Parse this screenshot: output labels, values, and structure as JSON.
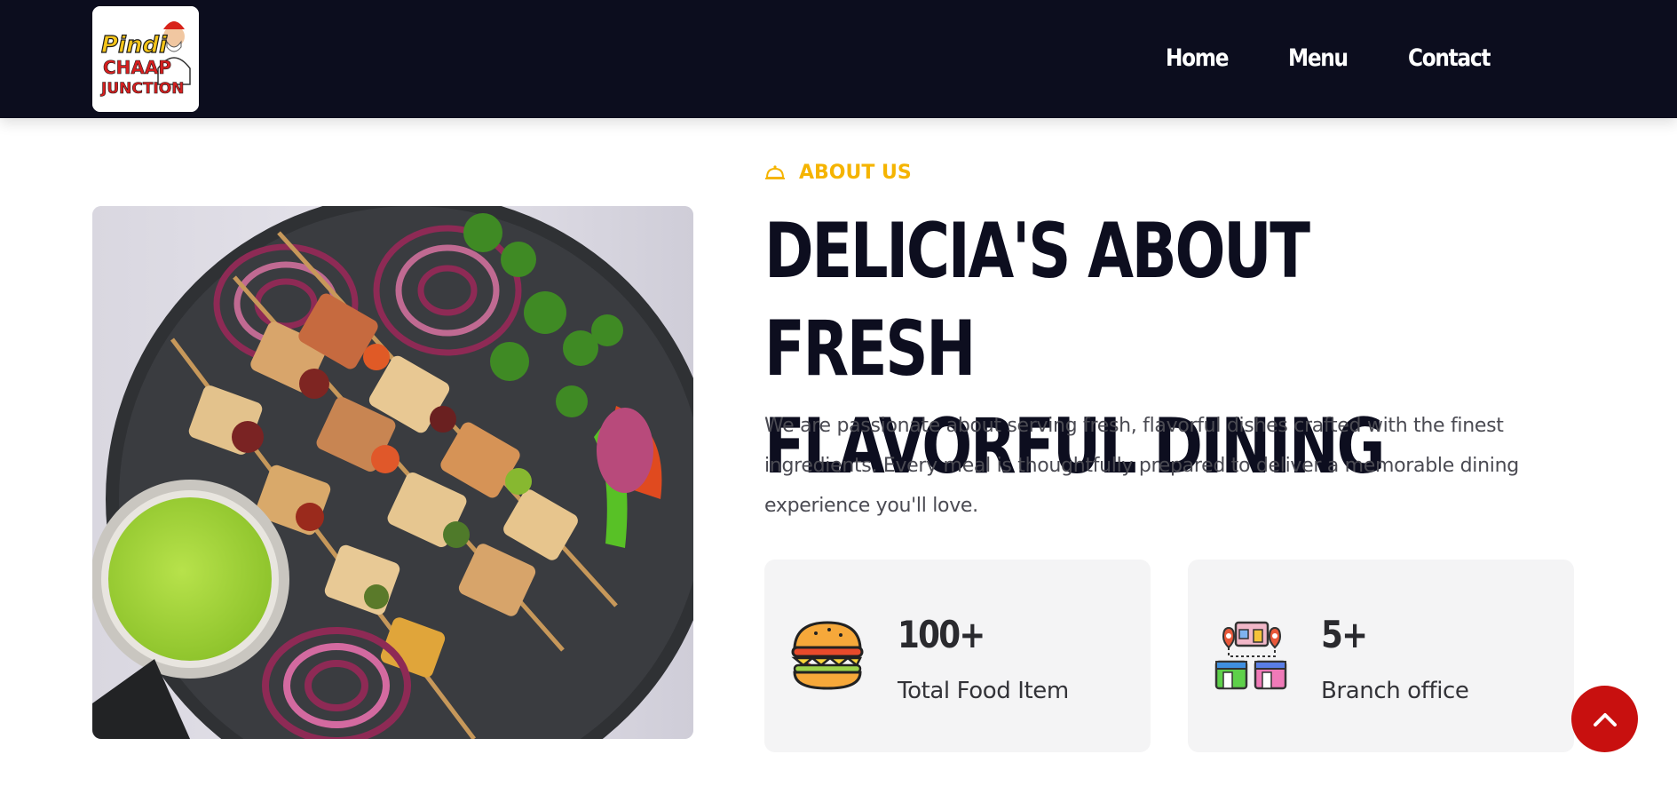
{
  "logo": {
    "alt": "Pindi Chaap Junction",
    "line1": "Pindi",
    "line2": "CHAAP",
    "line3": "JUNCTION"
  },
  "nav": {
    "items": [
      {
        "label": "Home"
      },
      {
        "label": "Menu"
      },
      {
        "label": "Contact"
      }
    ]
  },
  "about": {
    "eyebrow_icon": "cloche-icon",
    "eyebrow": "ABOUT US",
    "headline_line1": "DELICIA'S ABOUT FRESH",
    "headline_line2": "FLAVORFUL DINING",
    "description": "We are passionate about serving fresh, flavorful dishes crafted with the finest ingredients. Every meal is thoughtfully prepared to deliver a memorable dining experience you'll love."
  },
  "image": {
    "subject": "paneer-tikka-skewers-photo"
  },
  "stats": [
    {
      "icon": "burger-icon",
      "value": "100+",
      "label": "Total Food Item"
    },
    {
      "icon": "branch-stores-icon",
      "value": "5+",
      "label": "Branch office"
    }
  ],
  "scroll_top": {
    "icon": "chevron-up-icon"
  },
  "colors": {
    "header_bg": "#0c0d1e",
    "accent_yellow": "#f5b400",
    "scroll_button": "#c8100f",
    "card_bg": "#f4f4f5"
  }
}
